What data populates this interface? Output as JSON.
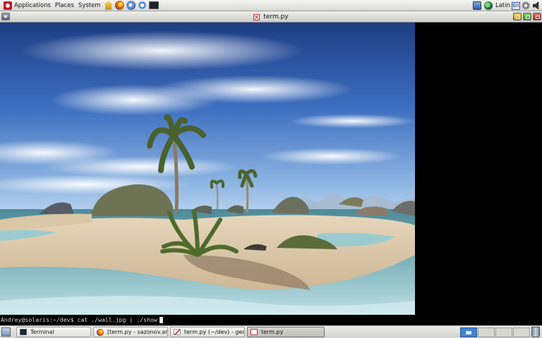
{
  "top_panel": {
    "menus": [
      "Applications",
      "Places",
      "System"
    ],
    "launchers": [
      "home-folder-icon",
      "firefox-icon",
      "thunderbird-icon",
      "refresh-icon",
      "terminal-icon"
    ],
    "tray": {
      "keyboard_layout": "Latin",
      "keyboard_indicator": "En"
    }
  },
  "window": {
    "title": "term.py"
  },
  "terminal": {
    "prompt": "Andrey@solaris:~/dev$ cat ./wall.jpg | ./show",
    "wallpaper": "tropical-beach-palms-render"
  },
  "taskbar": {
    "tasks": [
      {
        "label": "Terminal",
        "icon": "terminal-icon",
        "active": false
      },
      {
        "label": "[term.py - sazonov.an...",
        "icon": "firefox-icon",
        "active": false
      },
      {
        "label": "term.py (~/dev) - gedit",
        "icon": "gedit-icon",
        "active": false
      },
      {
        "label": "term.py",
        "icon": "term-py-icon",
        "active": true
      }
    ],
    "active_workspace": 1
  },
  "colors": {
    "panel": "#dcdcd7",
    "terminal_bg": "#000000",
    "workspace_active": "#3f83d1"
  }
}
